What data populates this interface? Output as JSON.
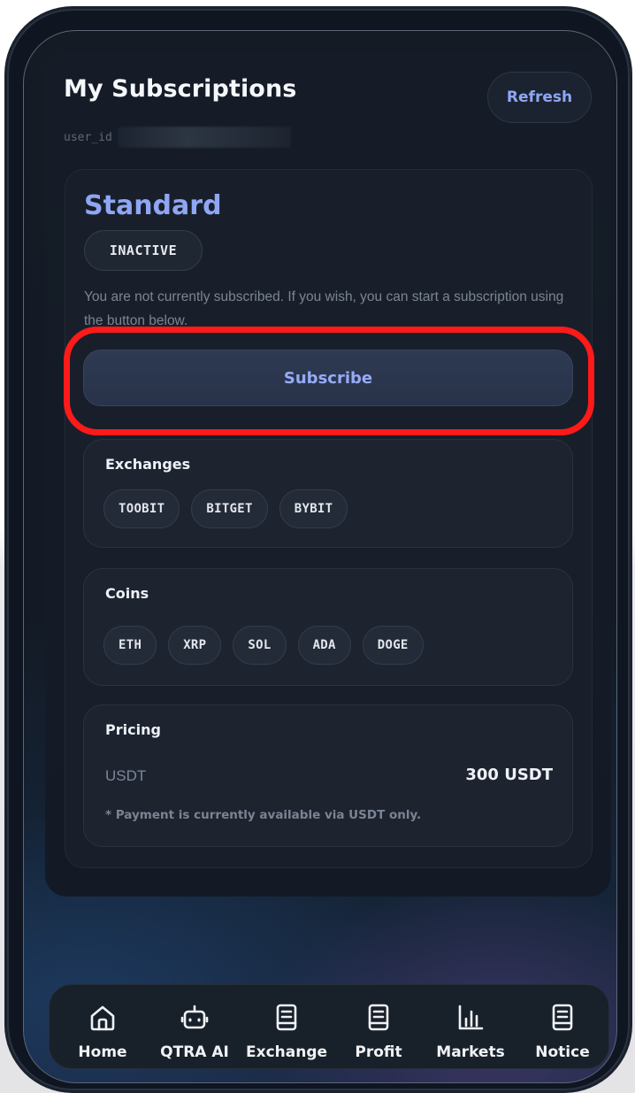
{
  "header": {
    "title": "My Subscriptions",
    "user_id_label": "user_id",
    "refresh_label": "Refresh"
  },
  "plan": {
    "name": "Standard",
    "status": "INACTIVE",
    "description": "You are not currently subscribed. If you wish, you can start a subscription using the button below.",
    "subscribe_label": "Subscribe"
  },
  "exchanges": {
    "title": "Exchanges",
    "items": [
      "TOOBIT",
      "BITGET",
      "BYBIT"
    ]
  },
  "coins": {
    "title": "Coins",
    "items": [
      "ETH",
      "XRP",
      "SOL",
      "ADA",
      "DOGE"
    ]
  },
  "pricing": {
    "title": "Pricing",
    "currency_label": "USDT",
    "amount": "300 USDT",
    "note": "* Payment is currently available via USDT only."
  },
  "nav": {
    "items": [
      {
        "label": "Home",
        "icon": "home-icon"
      },
      {
        "label": "QTRA AI",
        "icon": "robot-icon"
      },
      {
        "label": "Exchange",
        "icon": "document-icon"
      },
      {
        "label": "Profit",
        "icon": "document-icon"
      },
      {
        "label": "Markets",
        "icon": "bar-chart-icon"
      },
      {
        "label": "Notice",
        "icon": "document-icon"
      }
    ]
  },
  "colors": {
    "accent": "#8fa6f4",
    "highlight": "#ff1a1a",
    "background": "#131a25"
  }
}
